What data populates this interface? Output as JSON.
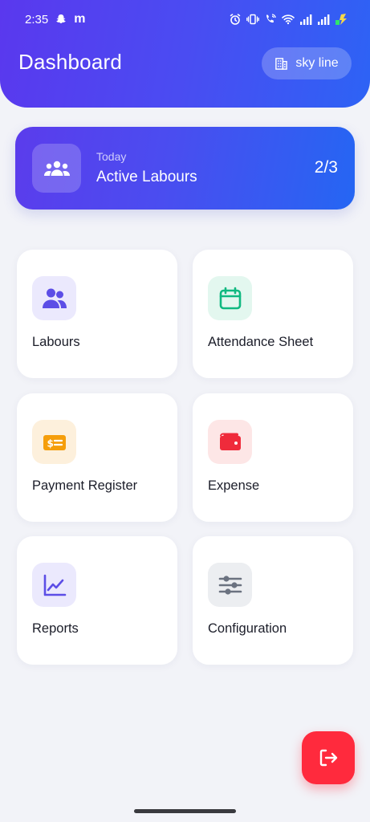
{
  "status_bar": {
    "time": "2:35",
    "carrier_glyph": "m",
    "icons": [
      "snapchat-icon",
      "alarm-icon",
      "vibrate-icon",
      "wifi-calling-icon",
      "wifi-icon",
      "signal-icon",
      "signal-icon",
      "battery-charging-icon"
    ]
  },
  "header": {
    "title": "Dashboard",
    "site_chip": {
      "icon": "building-icon",
      "label": "sky line"
    }
  },
  "active_card": {
    "icon": "group-icon",
    "caption": "Today",
    "title": "Active Labours",
    "count": "2/3"
  },
  "tiles": [
    {
      "label": "Labours",
      "icon": "users-icon",
      "icon_bg": "#ebe9fd",
      "icon_color": "#5c4ee6"
    },
    {
      "label": "Attendance Sheet",
      "icon": "calendar-icon",
      "icon_bg": "#e3f7ef",
      "icon_color": "#10b981"
    },
    {
      "label": "Payment Register",
      "icon": "payment-icon",
      "icon_bg": "#fdf0dc",
      "icon_color": "#f59e0b"
    },
    {
      "label": "Expense",
      "icon": "wallet-icon",
      "icon_bg": "#fde6e6",
      "icon_color": "#ef2b3b"
    },
    {
      "label": "Reports",
      "icon": "chart-line-icon",
      "icon_bg": "#ebe9fd",
      "icon_color": "#5c4ee6"
    },
    {
      "label": "Configuration",
      "icon": "sliders-icon",
      "icon_bg": "#eceef1",
      "icon_color": "#6b7280"
    }
  ],
  "fab": {
    "icon": "logout-icon",
    "color": "#ff2a3d"
  },
  "colors": {
    "header_gradient_start": "#5a38ee",
    "header_gradient_end": "#2d63f5",
    "background": "#f2f3f8"
  }
}
